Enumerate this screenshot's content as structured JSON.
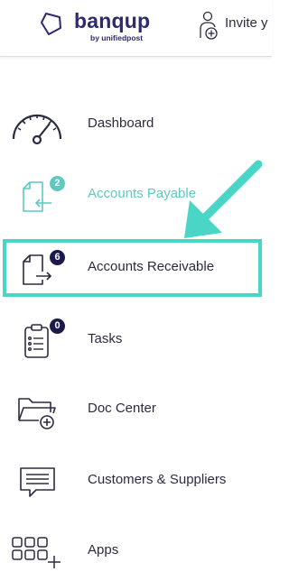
{
  "header": {
    "logo_text": "banqup",
    "logo_sub": "by unifiedpost",
    "invite_label": "Invite y"
  },
  "sidebar": {
    "items": [
      {
        "label": "Dashboard",
        "icon": "dashboard-gauge-icon"
      },
      {
        "label": "Accounts Payable",
        "icon": "accounts-payable-icon",
        "badge": "2"
      },
      {
        "label": "Accounts Receivable",
        "icon": "accounts-receivable-icon",
        "badge": "6"
      },
      {
        "label": "Tasks",
        "icon": "tasks-clipboard-icon",
        "badge": "0"
      },
      {
        "label": "Doc Center",
        "icon": "doc-center-folder-icon"
      },
      {
        "label": "Customers & Suppliers",
        "icon": "customers-suppliers-chat-icon"
      },
      {
        "label": "Apps",
        "icon": "apps-grid-icon"
      }
    ]
  },
  "colors": {
    "brand": "#2e2a6e",
    "accent": "#49d6c6",
    "payable_text": "#5fc9c0",
    "badge_dark": "#1c1a4a"
  }
}
